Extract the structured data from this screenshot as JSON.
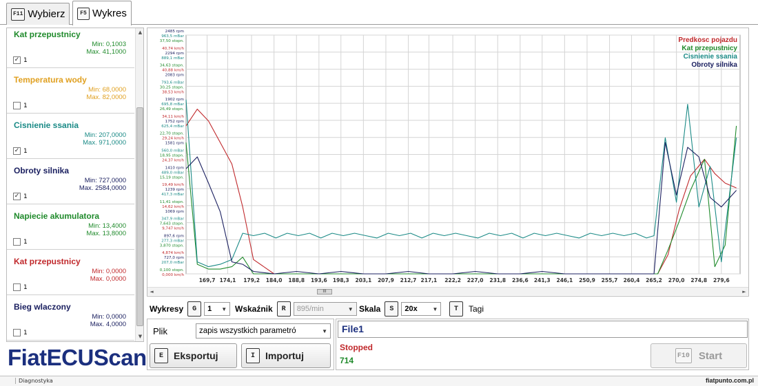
{
  "tabs": [
    {
      "key": "F11",
      "label": "Wybierz",
      "active": false
    },
    {
      "key": "F5",
      "label": "Wykres",
      "active": true
    }
  ],
  "params": [
    {
      "name": "Kat przepustnicy",
      "min": "Min: 0,1003",
      "max": "Max. 41,1000",
      "checked": true,
      "check_label": "1",
      "color": "#1f8a2b"
    },
    {
      "name": "Temperatura wody",
      "min": "Min: 68,0000",
      "max": "Max. 82,0000",
      "checked": false,
      "check_label": "1",
      "color": "#e0a020"
    },
    {
      "name": "Cisnienie ssania",
      "min": "Min: 207,0000",
      "max": "Max. 971,0000",
      "checked": true,
      "check_label": "1",
      "color": "#1a8a86"
    },
    {
      "name": "Obroty silnika",
      "min": "Min: 727,0000",
      "max": "Max. 2584,0000",
      "checked": true,
      "check_label": "1",
      "color": "#1b2060"
    },
    {
      "name": "Napiecie akumulatora",
      "min": "Min: 13,4000",
      "max": "Max. 13,8000",
      "checked": false,
      "check_label": "1",
      "color": "#1f8a2b"
    },
    {
      "name": "Kat przepustnicy",
      "min": "Min: 0,0000",
      "max": "Max. 0,0000",
      "checked": false,
      "check_label": "1",
      "color": "#c0282b"
    },
    {
      "name": "Bieg wlaczony",
      "min": "Min: 0,0000",
      "max": "Max. 4,0000",
      "checked": false,
      "check_label": "1",
      "color": "#1b2060"
    }
  ],
  "logo": "FiatECUScan",
  "colors": {
    "speed": "#c0282b",
    "throttle": "#1f8a2b",
    "pressure": "#1a8a86",
    "rpm": "#1b2060",
    "grid": "#d4d4d4"
  },
  "chart_data": {
    "type": "line",
    "x_ticks": [
      "169,7",
      "174,1",
      "179,2",
      "184,0",
      "188,8",
      "193,6",
      "198,3",
      "203,1",
      "207,9",
      "212,7",
      "217,1",
      "222,2",
      "227,0",
      "231,8",
      "236,6",
      "241,3",
      "246,1",
      "250,9",
      "255,7",
      "260,4",
      "265,2",
      "270,0",
      "274,8",
      "279,6"
    ],
    "xlim": [
      165.2,
      283.6
    ],
    "ylim": [
      0,
      1
    ],
    "y_tick_rows": [
      [
        "2485 rpm",
        "963,5 mBar",
        "37,50 stopn."
      ],
      [
        "40,74 km/h",
        "2294 rpm",
        "889,1 mBar"
      ],
      [
        "34,63 stopn.",
        "40,88 km/h",
        "2083 rpm"
      ],
      [
        "793,6 mBar",
        "30,25 stopn.",
        "38,53 km/h"
      ],
      [
        "1902 rpm",
        "695,8 mBar",
        "26,49 stopn."
      ],
      [
        "34,11 km/h",
        "1752 rpm",
        "625,4 mBar"
      ],
      [
        "22,70 stopn.",
        "29,24 km/h",
        "1581 rpm"
      ],
      [
        "560,0 mBar",
        "18,95 stopn.",
        "24,37 km/h"
      ],
      [
        "1410 rpm",
        "489,0 mBar",
        "15,19 stopn."
      ],
      [
        "19,49 km/h",
        "1239 rpm",
        "417,3 mBar"
      ],
      [
        "11,41 stopn.",
        "14,62 km/h",
        "1069 rpm"
      ],
      [
        "347,9 mBar",
        "7,643 stopn.",
        "9,747 km/h"
      ],
      [
        "897,6 rpm",
        "277,3 mBar",
        "3,870 stopn."
      ],
      [
        "4,874 km/h",
        "727,0 rpm",
        "207,0 mBar"
      ],
      [
        "0,100 stopn.",
        "0,000 km/h",
        ""
      ]
    ],
    "series": [
      {
        "name": "Predkosc pojazdu",
        "color": "#c0282b",
        "x": [
          165.2,
          167.6,
          170.0,
          172.5,
          175.0,
          177.3,
          179.6,
          184.0,
          200.0,
          220.0,
          240.0,
          255.0,
          266.0,
          268.2,
          270.6,
          273.0,
          276.0,
          278.2,
          280.4,
          282.8
        ],
        "values": [
          0.62,
          0.69,
          0.64,
          0.55,
          0.46,
          0.28,
          0.06,
          0.0,
          0.0,
          0.0,
          0.0,
          0.0,
          0.0,
          0.08,
          0.27,
          0.41,
          0.48,
          0.42,
          0.38,
          0.36
        ]
      },
      {
        "name": "Kat przepustnicy",
        "color": "#1f8a2b",
        "x": [
          165.2,
          167.6,
          170.0,
          172.5,
          175.0,
          177.3,
          179.6,
          184.0,
          200.0,
          220.0,
          240.0,
          255.0,
          266.0,
          268.2,
          270.6,
          273.0,
          276.0,
          278.2,
          280.4,
          282.8
        ],
        "values": [
          0.55,
          0.04,
          0.02,
          0.02,
          0.03,
          0.07,
          0.0,
          0.0,
          0.0,
          0.0,
          0.0,
          0.0,
          0.0,
          0.1,
          0.22,
          0.35,
          0.48,
          0.03,
          0.12,
          0.62
        ]
      },
      {
        "name": "Cisnienie ssania",
        "color": "#1a8a86",
        "x": [
          165.2,
          167.6,
          170.0,
          172.5,
          175.0,
          177.3,
          179.6,
          182.0,
          184.4,
          186.8,
          189.2,
          191.6,
          194.0,
          196.4,
          198.8,
          201.2,
          203.6,
          206.0,
          208.4,
          210.8,
          213.2,
          215.6,
          218.0,
          220.4,
          222.8,
          225.2,
          227.6,
          230.0,
          232.4,
          234.8,
          237.2,
          239.6,
          242.0,
          244.4,
          246.8,
          249.2,
          251.6,
          254.0,
          256.4,
          258.8,
          261.2,
          263.6,
          265.2,
          267.6,
          270.0,
          272.4,
          274.8,
          277.2,
          279.6,
          282.8
        ],
        "values": [
          0.73,
          0.05,
          0.03,
          0.04,
          0.06,
          0.17,
          0.16,
          0.17,
          0.15,
          0.17,
          0.16,
          0.17,
          0.15,
          0.17,
          0.16,
          0.17,
          0.16,
          0.15,
          0.17,
          0.16,
          0.17,
          0.15,
          0.17,
          0.16,
          0.17,
          0.16,
          0.15,
          0.17,
          0.16,
          0.17,
          0.15,
          0.17,
          0.16,
          0.17,
          0.16,
          0.15,
          0.17,
          0.16,
          0.17,
          0.16,
          0.17,
          0.15,
          0.16,
          0.57,
          0.3,
          0.71,
          0.28,
          0.45,
          0.05,
          0.57
        ]
      },
      {
        "name": "Obroty silnika",
        "color": "#1b2060",
        "x": [
          165.2,
          167.6,
          170.0,
          172.5,
          175.0,
          177.3,
          179.6,
          184.0,
          188.8,
          193.6,
          198.3,
          203.1,
          207.9,
          212.7,
          217.1,
          222.2,
          227.0,
          231.8,
          236.6,
          241.3,
          246.1,
          250.9,
          255.7,
          260.4,
          265.2,
          267.6,
          270.0,
          272.4,
          274.8,
          277.2,
          279.6,
          282.8
        ],
        "values": [
          0.44,
          0.49,
          0.38,
          0.26,
          0.05,
          0.04,
          0.01,
          0.0,
          0.01,
          0.0,
          0.01,
          0.0,
          0.0,
          0.01,
          0.0,
          0.0,
          0.01,
          0.0,
          0.0,
          0.01,
          0.0,
          0.0,
          0.0,
          0.0,
          0.0,
          0.55,
          0.33,
          0.53,
          0.49,
          0.32,
          0.28,
          0.35
        ]
      }
    ],
    "legend_position": "top-right",
    "grid": true
  },
  "controls": {
    "wykresy_label": "Wykresy",
    "wykresy_key": "G",
    "wykresy_value": "1",
    "wskaznik_label": "Wskaźnik",
    "wskaznik_key": "R",
    "wskaznik_value": "895/min",
    "skala_label": "Skala",
    "skala_key": "S",
    "skala_value": "20x",
    "tagi_key": "T",
    "tagi_label": "Tagi"
  },
  "file": {
    "plik_label": "Plik",
    "plik_value": "zapis wszystkich parametró",
    "export_key": "E",
    "export_label": "Eksportuj",
    "import_key": "I",
    "import_label": "Importuj"
  },
  "status": {
    "filename": "File1",
    "state": "Stopped",
    "count": "714",
    "start_key": "F10",
    "start_label": "Start"
  },
  "statusbar": {
    "item": "Diagnostyka"
  },
  "watermark": "fiatpunto.com.pl"
}
